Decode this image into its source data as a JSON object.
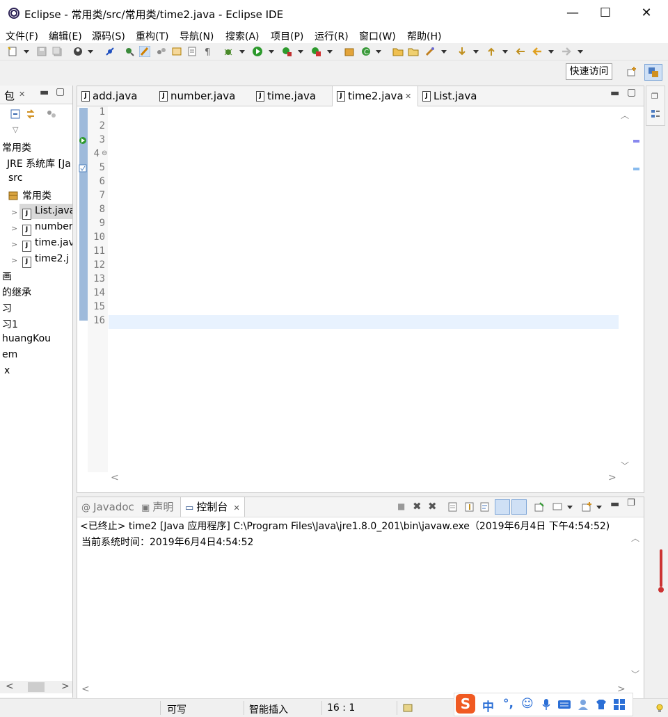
{
  "window": {
    "title": "Eclipse - 常用类/src/常用类/time2.java - Eclipse IDE",
    "minimize": "—",
    "maximize": "☐",
    "close": "✕"
  },
  "menu": [
    "文件(F)",
    "编辑(E)",
    "源码(S)",
    "重构(T)",
    "导航(N)",
    "搜索(A)",
    "项目(P)",
    "运行(R)",
    "窗口(W)",
    "帮助(H)"
  ],
  "quick_access": "快速访问",
  "package_explorer": {
    "tab_label": "包",
    "tab_close": "✕",
    "items": [
      {
        "text": "常用类"
      },
      {
        "text": "JRE 系统库 [Ja"
      },
      {
        "text": "src"
      },
      {
        "text": "常用类"
      },
      {
        "text": "List.java"
      },
      {
        "text": "number"
      },
      {
        "text": "time.jav"
      },
      {
        "text": "time2.j"
      },
      {
        "text": "画"
      },
      {
        "text": "的继承"
      },
      {
        "text": "习"
      },
      {
        "text": "习1"
      },
      {
        "text": "huangKou"
      },
      {
        "text": "em"
      },
      {
        "text": "x"
      }
    ]
  },
  "editor": {
    "tabs": [
      "add.java",
      "number.java",
      "time.java",
      "time2.java",
      "List.java"
    ],
    "active_tab": "time2.java",
    "tab_close": "✕",
    "line_numbers": [
      "1",
      "2",
      "3",
      "4",
      "5",
      "6",
      "7",
      "8",
      "9",
      "10",
      "11",
      "12",
      "13",
      "14",
      "15",
      "16"
    ]
  },
  "console": {
    "tabs": [
      "Javadoc",
      "声明",
      "控制台"
    ],
    "active_tab": "控制台",
    "tab_close": "✕",
    "status": "<已终止> time2 [Java 应用程序] C:\\Program Files\\Java\\jre1.8.0_201\\bin\\javaw.exe（2019年6月4日 下午4:54:52)",
    "output": "当前系统时间：2019年6月4日4:54:52"
  },
  "statusbar": {
    "writable": "可写",
    "insert_mode": "智能插入",
    "position": "16 : 1"
  },
  "ime": {
    "logo": "S",
    "lang": "中",
    "punct": "°,"
  },
  "colors": {
    "keyword": "#7f0055",
    "string": "#2a00ff",
    "field": "#0000c0",
    "comment": "#3f7f5f",
    "current_line": "#e8f2fe"
  }
}
